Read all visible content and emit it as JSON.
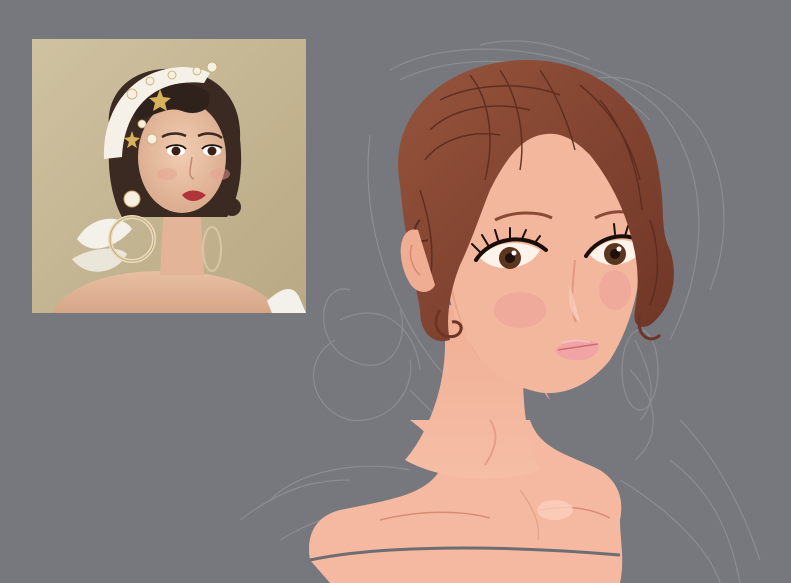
{
  "canvas": {
    "background": "#76787d"
  },
  "reference_photo": {
    "subject": "portrait-photo",
    "background_color": "#c9bb98",
    "skin_color": "#e7bfa2",
    "hair_color": "#3a2a22",
    "lip_color": "#b0343a"
  },
  "illustration": {
    "subject": "digital-painting-in-progress",
    "hair_color": "#8b4a35",
    "hair_shadow": "#6e3526",
    "skin_color": "#f3b79e",
    "skin_shadow": "#e6a088",
    "blush_color": "#eda39a",
    "lip_color": "#f2a3a5",
    "eye_color": "#5a3520",
    "sketch_line_color": "#8e9096"
  }
}
